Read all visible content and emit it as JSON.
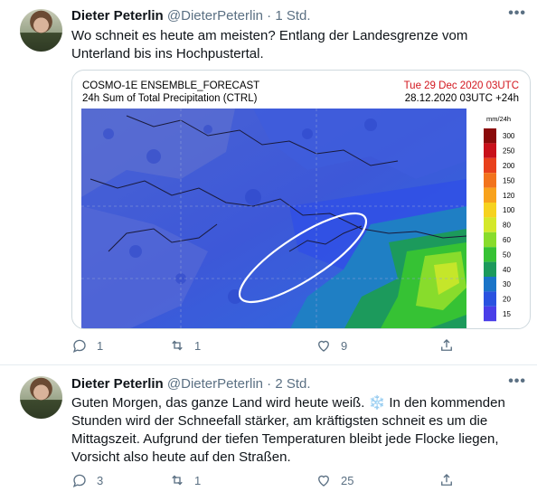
{
  "tweets": [
    {
      "name": "Dieter Peterlin",
      "handle": "@DieterPeterlin",
      "separator": "·",
      "time": "1 Std.",
      "text": "Wo schneit es heute am meisten? Entlang der Landesgrenze vom Unterland bis ins Hochpustertal.",
      "media": {
        "title_line1": "COSMO-1E ENSEMBLE_FORECAST",
        "title_line2": "24h Sum of Total Precipitation (CTRL)",
        "valid_date": "Tue 29 Dec 2020 03UTC",
        "run_date": "28.12.2020 03UTC +24h",
        "legend_unit": "mm/24h",
        "legend_levels": [
          "300",
          "250",
          "200",
          "150",
          "120",
          "100",
          "80",
          "60",
          "50",
          "40",
          "30",
          "20",
          "15"
        ],
        "legend_colors": [
          "#8a0a0a",
          "#c8101a",
          "#e8401c",
          "#f2731c",
          "#f8a21c",
          "#f6d21e",
          "#d4e82a",
          "#88dc2c",
          "#36c234",
          "#1c9a5c",
          "#1a74c8",
          "#2a52e0",
          "#4a3ee8"
        ]
      },
      "actions": {
        "reply": "1",
        "retweet": "1",
        "like": "9"
      }
    },
    {
      "name": "Dieter Peterlin",
      "handle": "@DieterPeterlin",
      "separator": "·",
      "time": "2 Std.",
      "text_part1": "Guten Morgen, das ganze Land wird heute weiß. ",
      "text_emoji": "❄️",
      "text_part2": " In den kommenden Stunden wird der Schneefall stärker, am kräftigsten schneit es um die Mittagszeit. Aufgrund der tiefen Temperaturen bleibt jede Flocke liegen, Vorsicht also heute auf den Straßen.",
      "actions": {
        "reply": "3",
        "retweet": "1",
        "like": "25"
      }
    }
  ],
  "more_icon": "more-horizontal-icon",
  "colors": {
    "link_gray": "#5b7083",
    "ellipse": "#ffffff"
  }
}
